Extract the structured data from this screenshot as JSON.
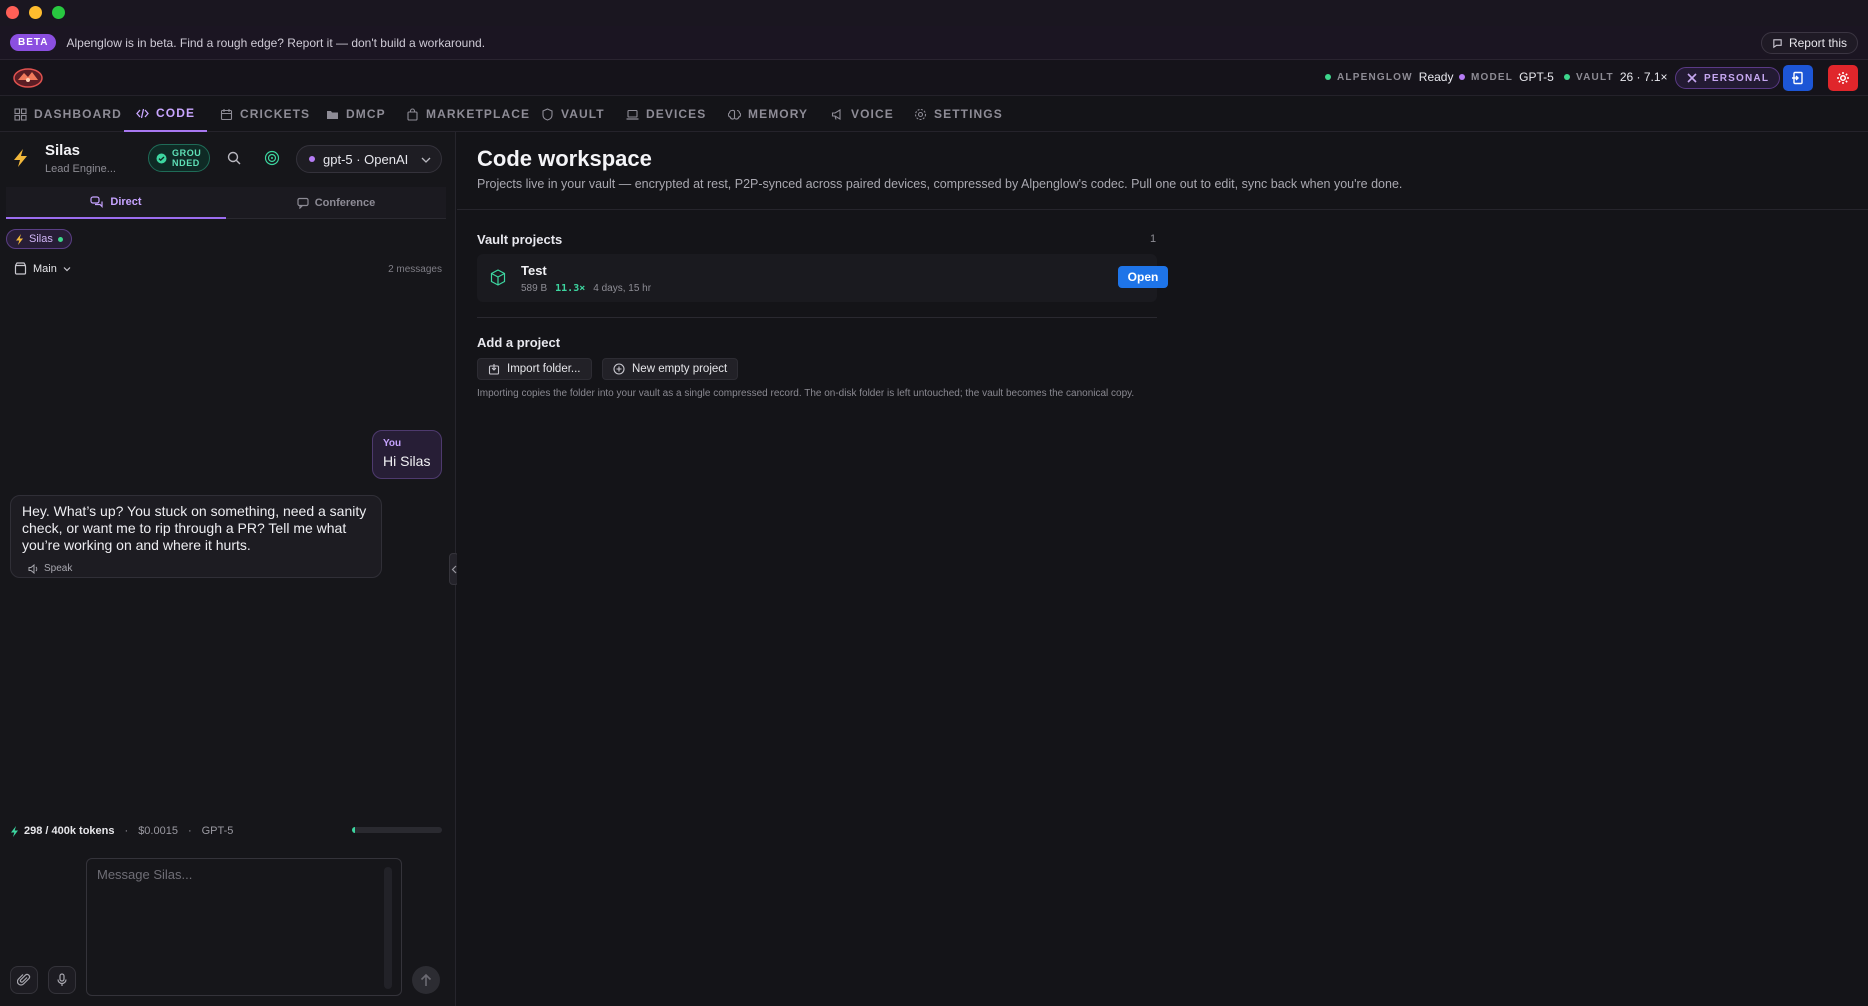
{
  "beta": {
    "badge": "BETA",
    "message": "Alpenglow is in beta. Find a rough edge? Report it — don't build a workaround.",
    "report_label": "Report this"
  },
  "status": {
    "items": [
      {
        "key": "ALPENGLOW",
        "value": "Ready",
        "dot": "#3dd68c"
      },
      {
        "key": "MODEL",
        "value": "GPT-5",
        "dot": "#b67cf5"
      },
      {
        "key": "VAULT",
        "value": "26 · 7.1×",
        "dot": "#3dd68c"
      }
    ],
    "personal_label": "PERSONAL"
  },
  "nav": {
    "tabs": [
      {
        "label": "DASHBOARD",
        "icon": "grid-icon"
      },
      {
        "label": "CODE",
        "icon": "code-icon",
        "active": true
      },
      {
        "label": "CRICKETS",
        "icon": "calendar-icon"
      },
      {
        "label": "DMCP",
        "icon": "folder-icon"
      },
      {
        "label": "MARKETPLACE",
        "icon": "bag-icon"
      },
      {
        "label": "VAULT",
        "icon": "shield-icon"
      },
      {
        "label": "DEVICES",
        "icon": "laptop-icon"
      },
      {
        "label": "MEMORY",
        "icon": "brain-icon"
      },
      {
        "label": "VOICE",
        "icon": "megaphone-icon"
      },
      {
        "label": "SETTINGS",
        "icon": "gear-icon"
      }
    ]
  },
  "agent": {
    "name": "Silas",
    "role": "Lead Engine...",
    "grounded_label": "GROU NDED",
    "model_label": "gpt-5 · OpenAI"
  },
  "subtabs": {
    "direct": "Direct",
    "conference": "Conference"
  },
  "chip": {
    "label": "Silas"
  },
  "thread": {
    "name": "Main",
    "count": "2 messages"
  },
  "messages": {
    "user_label": "You",
    "user_text": "Hi Silas",
    "assistant_text": "Hey. What’s up? You stuck on something, need a sanity check, or want me to rip through a PR? Tell me what you’re working on and where it hurts.",
    "speak_label": "Speak"
  },
  "usage": {
    "tokens": "298 / 400k tokens",
    "cost": "$0.0015",
    "model": "GPT-5",
    "fraction": 0.03
  },
  "composer": {
    "placeholder": "Message Silas..."
  },
  "workspace": {
    "title": "Code workspace",
    "subtitle": "Projects live in your vault — encrypted at rest, P2P-synced across paired devices, compressed by Alpenglow's codec. Pull one out to edit, sync back when you're done.",
    "vault_title": "Vault projects",
    "vault_count": "1",
    "project": {
      "name": "Test",
      "size": "589 B",
      "ratio": "11.3×",
      "age": "4 days, 15 hr",
      "open_label": "Open"
    },
    "add_title": "Add a project",
    "import_label": "Import folder...",
    "new_label": "New empty project",
    "hint": "Importing copies the folder into your vault as a single compressed record. The on-disk folder is left untouched; the vault becomes the canonical copy."
  }
}
